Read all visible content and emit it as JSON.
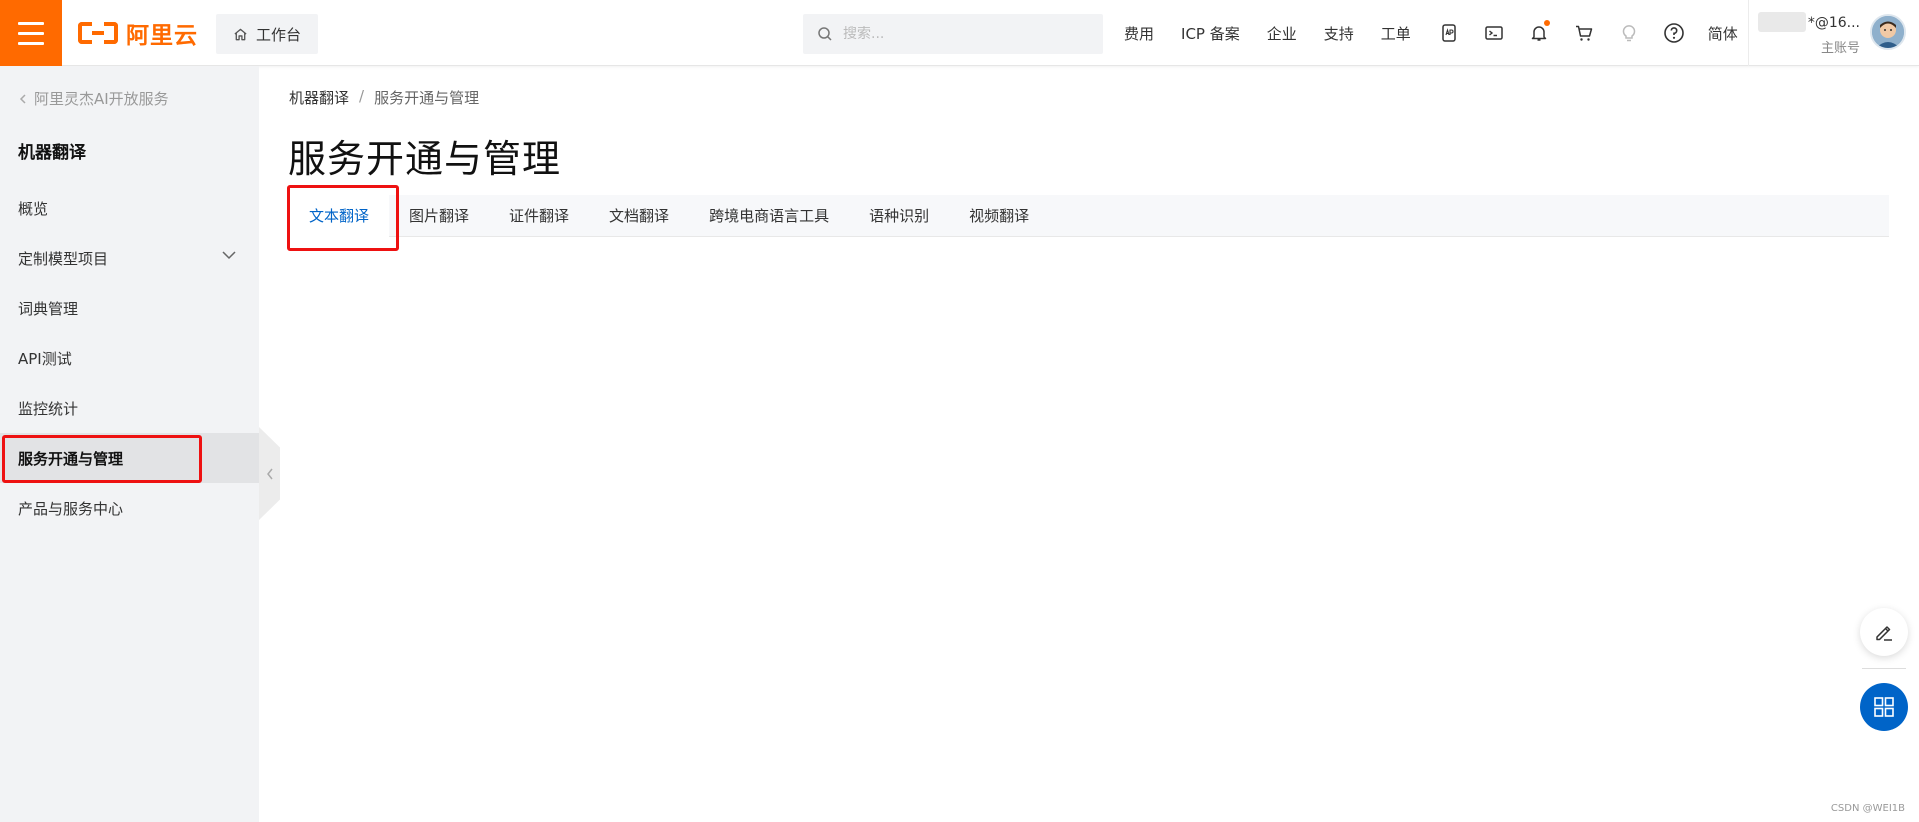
{
  "topbar": {
    "logo_text": "阿里云",
    "workbench_label": "工作台",
    "search_placeholder": "搜索...",
    "links": [
      "费用",
      "ICP 备案",
      "企业",
      "支持",
      "工单"
    ],
    "icons": [
      "app-icon",
      "terminal-icon",
      "bell-icon",
      "cart-icon",
      "lightbulb-icon",
      "help-icon"
    ],
    "lang": "简体",
    "account_name": "*@16...",
    "account_role": "主账号",
    "accent_color": "#ff6a00"
  },
  "sidebar": {
    "back_label": "阿里灵杰AI开放服务",
    "title": "机器翻译",
    "items": [
      {
        "label": "概览"
      },
      {
        "label": "定制模型项目"
      },
      {
        "label": "词典管理"
      },
      {
        "label": "API测试"
      },
      {
        "label": "监控统计"
      },
      {
        "label": "服务开通与管理"
      },
      {
        "label": "产品与服务中心"
      }
    ]
  },
  "main": {
    "breadcrumb": [
      "机器翻译",
      "服务开通与管理"
    ],
    "title": "服务开通与管理",
    "tabs": [
      {
        "label": "文本翻译"
      },
      {
        "label": "图片翻译"
      },
      {
        "label": "证件翻译"
      },
      {
        "label": "文档翻译"
      },
      {
        "label": "跨境电商语言工具"
      },
      {
        "label": "语种识别"
      },
      {
        "label": "视频翻译"
      }
    ],
    "active_tab_color": "#0064c8"
  },
  "watermark": "CSDN @WEI1B"
}
